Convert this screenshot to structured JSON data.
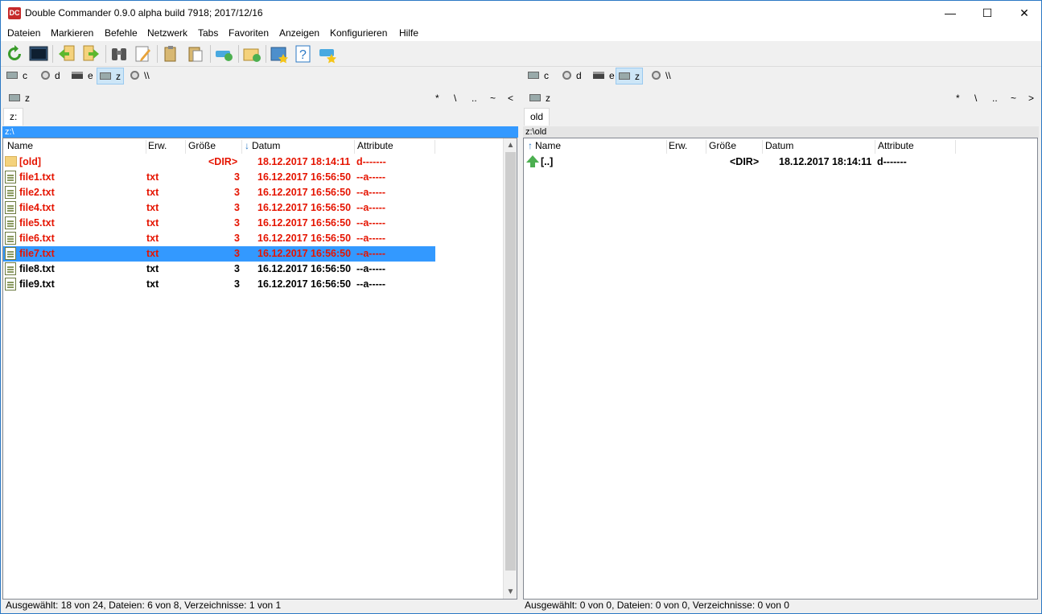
{
  "window": {
    "title": "Double Commander 0.9.0 alpha build 7918; 2017/12/16",
    "app_icon_text": "DC",
    "minimize": "—",
    "maximize": "☐",
    "close": "✕"
  },
  "menu": [
    "Dateien",
    "Markieren",
    "Befehle",
    "Netzwerk",
    "Tabs",
    "Favoriten",
    "Anzeigen",
    "Konfigurieren",
    "Hilfe"
  ],
  "drives": [
    "c",
    "d",
    "e",
    "z",
    "\\\\"
  ],
  "left": {
    "path_drive": "z",
    "nav": [
      "*",
      "\\",
      "..",
      "~",
      "<"
    ],
    "tab": "z:",
    "current_path": "z:\\",
    "columns": [
      "Name",
      "Erw.",
      "Größe",
      "Datum",
      "Attribute"
    ],
    "rows": [
      {
        "name": "[old]",
        "ext": "",
        "size": "<DIR>",
        "date": "18.12.2017 18:14:11",
        "attr": "d-------"
      },
      {
        "name": "file1.txt",
        "ext": "txt",
        "size": "3",
        "date": "16.12.2017 16:56:50",
        "attr": "--a-----"
      },
      {
        "name": "file2.txt",
        "ext": "txt",
        "size": "3",
        "date": "16.12.2017 16:56:50",
        "attr": "--a-----"
      },
      {
        "name": "file4.txt",
        "ext": "txt",
        "size": "3",
        "date": "16.12.2017 16:56:50",
        "attr": "--a-----"
      },
      {
        "name": "file5.txt",
        "ext": "txt",
        "size": "3",
        "date": "16.12.2017 16:56:50",
        "attr": "--a-----"
      },
      {
        "name": "file6.txt",
        "ext": "txt",
        "size": "3",
        "date": "16.12.2017 16:56:50",
        "attr": "--a-----"
      },
      {
        "name": "file7.txt",
        "ext": "txt",
        "size": "3",
        "date": "16.12.2017 16:56:50",
        "attr": "--a-----"
      },
      {
        "name": "file8.txt",
        "ext": "txt",
        "size": "3",
        "date": "16.12.2017 16:56:50",
        "attr": "--a-----"
      },
      {
        "name": "file9.txt",
        "ext": "txt",
        "size": "3",
        "date": "16.12.2017 16:56:50",
        "attr": "--a-----"
      }
    ],
    "status": "Ausgewählt: 18 von 24, Dateien: 6 von 8, Verzeichnisse: 1 von 1"
  },
  "right": {
    "path_drive": "z",
    "nav": [
      "*",
      "\\",
      "..",
      "~",
      ">"
    ],
    "tab": "old",
    "current_path": "z:\\old",
    "columns": [
      "Name",
      "Erw.",
      "Größe",
      "Datum",
      "Attribute"
    ],
    "rows": [
      {
        "name": "[..]",
        "ext": "",
        "size": "<DIR>",
        "date": "18.12.2017 18:14:11",
        "attr": "d-------"
      }
    ],
    "status": "Ausgewählt: 0 von 0, Dateien: 0 von 0, Verzeichnisse: 0 von 0"
  },
  "colors": {
    "marked": "#e51400",
    "cursor": "#3399ff",
    "active_path": "#3399ff"
  }
}
